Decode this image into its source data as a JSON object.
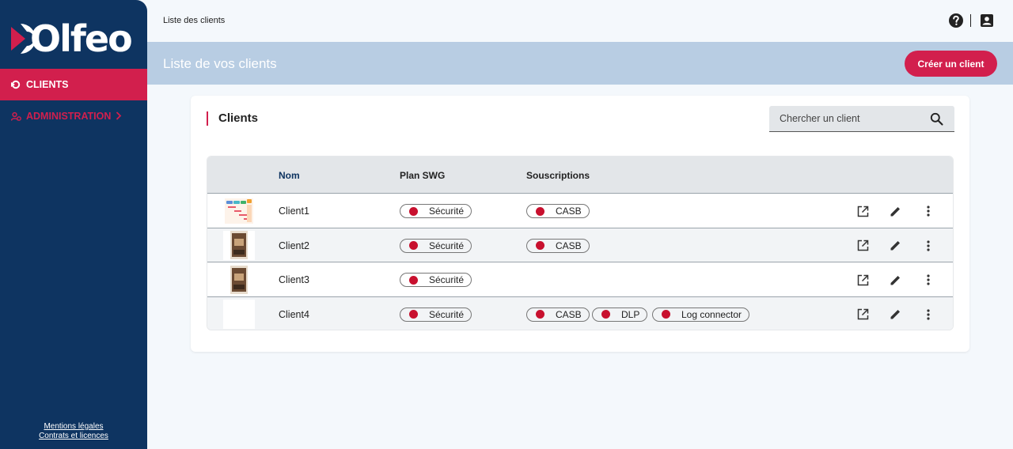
{
  "app": {
    "logo_text": "Olfeo",
    "brand_color": "#d21f4d",
    "sidebar_color": "#0e3461"
  },
  "sidebar": {
    "items": [
      {
        "label": "CLIENTS",
        "icon": "clients-icon",
        "active": true
      },
      {
        "label": "ADMINISTRATION",
        "icon": "admin-icon",
        "active": false
      }
    ],
    "footer": {
      "legal": "Mentions légales",
      "contracts": "Contrats et licences"
    }
  },
  "topbar": {
    "breadcrumb": "Liste des clients",
    "icons": [
      "help-icon",
      "account-icon"
    ]
  },
  "header": {
    "title": "Liste de vos clients",
    "create_button": "Créer un client"
  },
  "card": {
    "title": "Clients",
    "search_placeholder": "Chercher un client"
  },
  "table": {
    "columns": [
      "",
      "Nom",
      "Plan SWG",
      "Souscriptions",
      ""
    ],
    "rows": [
      {
        "name": "Client1",
        "thumbnail": "screenshot-thumbnail",
        "plan": "Sécurité",
        "subscriptions": [
          "CASB"
        ]
      },
      {
        "name": "Client2",
        "thumbnail": "product-thumbnail",
        "plan": "Sécurité",
        "subscriptions": [
          "CASB"
        ]
      },
      {
        "name": "Client3",
        "thumbnail": "product-thumbnail",
        "plan": "Sécurité",
        "subscriptions": []
      },
      {
        "name": "Client4",
        "thumbnail": "blank-thumbnail",
        "plan": "Sécurité",
        "subscriptions": [
          "CASB",
          "DLP",
          "Log connector"
        ]
      }
    ],
    "row_actions": [
      "open-external-icon",
      "edit-icon",
      "more-vert-icon"
    ],
    "status_dot_color": "#c8102e"
  }
}
